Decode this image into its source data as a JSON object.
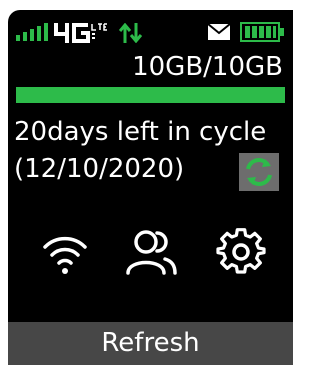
{
  "status_bar": {
    "network_type": "4G LTE",
    "signal_bars": 5,
    "battery_level": 1.0,
    "icons": [
      "signal-icon",
      "network-4g-lte-icon",
      "data-transfer-arrows-icon",
      "mail-icon",
      "battery-icon"
    ]
  },
  "usage": {
    "text": "10GB/10GB",
    "fraction": 1.0
  },
  "cycle": {
    "days_left": "20days left in cycle",
    "date": "(12/10/2020)"
  },
  "shortcuts": {
    "icons": [
      "wifi-icon",
      "users-icon",
      "settings-icon"
    ]
  },
  "footer": {
    "button_label": "Refresh"
  },
  "colors": {
    "accent_green": "#2dbb4a",
    "background": "#000000",
    "footer": "#474747"
  }
}
